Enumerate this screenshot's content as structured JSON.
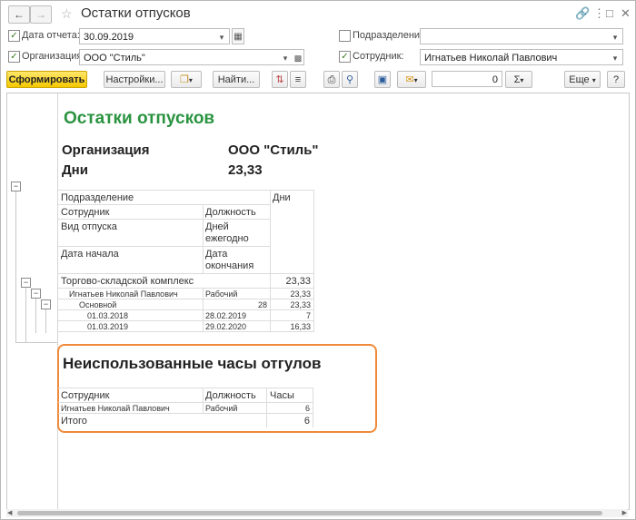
{
  "window": {
    "title": "Остатки отпусков"
  },
  "title_icons": [
    "link-icon",
    "more-icon",
    "maximize-icon",
    "close-icon"
  ],
  "filters": {
    "report_date_label": "Дата отчета:",
    "report_date_value": "30.09.2019",
    "organization_label": "Организация:",
    "organization_value": "ООО \"Стиль\"",
    "department_label": "Подразделение:",
    "department_value": "",
    "employee_label": "Сотрудник:",
    "employee_value": "Игнатьев Николай Павлович"
  },
  "toolbar": {
    "generate": "Сформировать",
    "settings": "Настройки...",
    "find": "Найти...",
    "number_value": "0",
    "sum_symbol": "Σ",
    "more": "Еще",
    "help": "?"
  },
  "report": {
    "title": "Остатки отпусков",
    "org_label": "Организация",
    "org_value": "ООО \"Стиль\"",
    "days_label": "Дни",
    "days_value": "23,33",
    "head": {
      "department": "Подразделение",
      "days": "Дни",
      "employee": "Сотрудник",
      "position": "Должность",
      "leave_type": "Вид отпуска",
      "days_annual_1": "Дней",
      "days_annual_2": "ежегодно",
      "start_date": "Дата начала",
      "end_date_1": "Дата",
      "end_date_2": "окончания"
    },
    "rows": {
      "department_name": "Торгово-складской комплекс",
      "department_days": "23,33",
      "employee_name": "Игнатьев Николай Павлович",
      "employee_position": "Рабочий",
      "employee_days": "23,33",
      "leave_name": "Основной",
      "leave_annual": "28",
      "leave_days": "23,33",
      "period1_start": "01.03.2018",
      "period1_end": "28.02.2019",
      "period1_days": "7",
      "period2_start": "01.03.2019",
      "period2_end": "29.02.2020",
      "period2_days": "16,33"
    },
    "section2": {
      "title": "Неиспользованные часы отгулов",
      "col_employee": "Сотрудник",
      "col_position": "Должность",
      "col_hours": "Часы",
      "row_employee": "Игнатьев Николай Павлович",
      "row_position": "Рабочий",
      "row_hours": "6",
      "total_label": "Итого",
      "total_hours": "6"
    }
  },
  "colors": {
    "accent_title": "#2a9340",
    "primary_button": "#f5c800",
    "highlight": "#ef8a3a"
  }
}
